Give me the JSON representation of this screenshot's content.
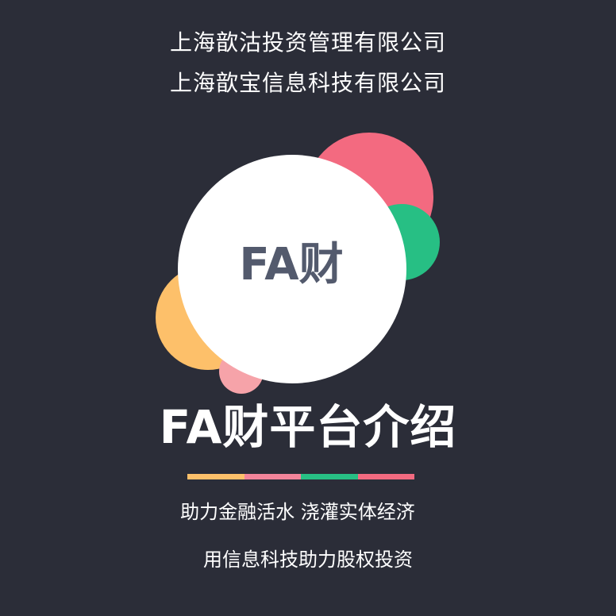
{
  "header": {
    "company_line_1": "上海歆沽投资管理有限公司",
    "company_line_2": "上海歆宝信息科技有限公司"
  },
  "logo": {
    "text": "FA财",
    "circle_colors": {
      "main": "#ffffff",
      "pink": "#f36a80",
      "green": "#27bf84",
      "orange": "#fdc06a",
      "light_pink": "#f6a3a9"
    }
  },
  "title": "FA财平台介绍",
  "divider_colors": [
    "#fdc06a",
    "#f3849a",
    "#27bf84",
    "#f36a80"
  ],
  "taglines": {
    "line_1": "助力金融活水 浇灌实体经济",
    "line_2": "用信息科技助力股权投资"
  },
  "colors": {
    "background": "#2b2d38",
    "text": "#ffffff",
    "logo_text": "#535a6d"
  }
}
